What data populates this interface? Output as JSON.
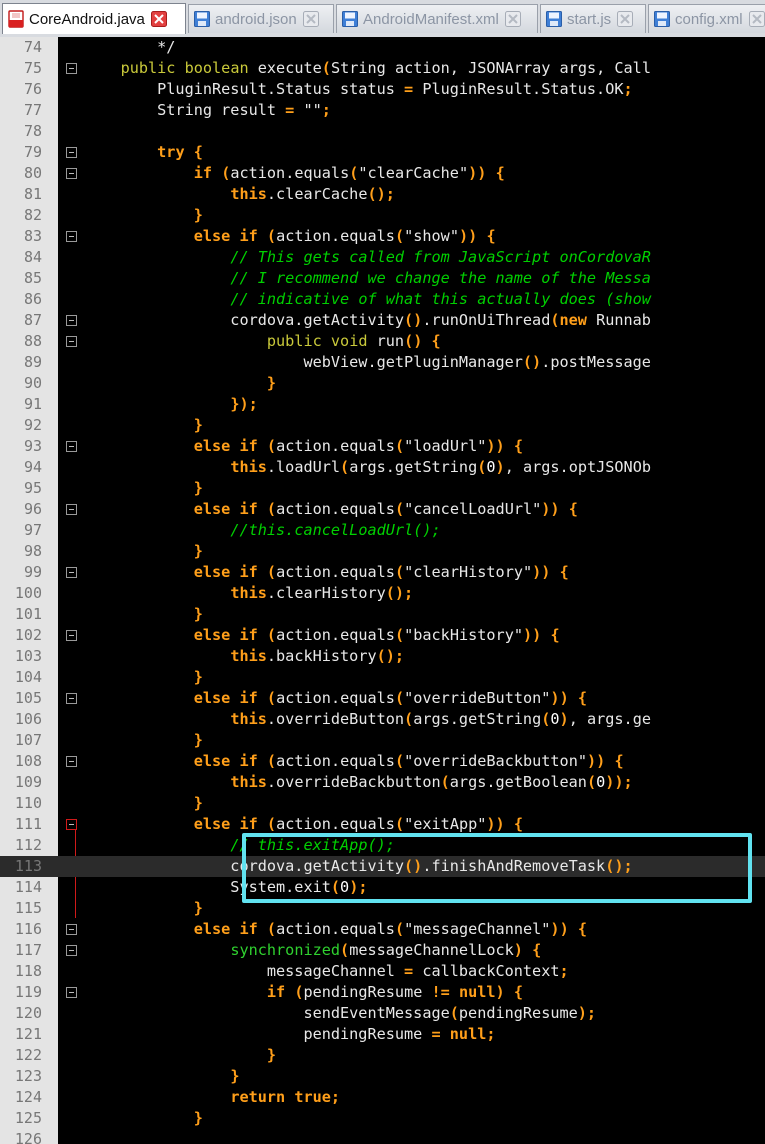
{
  "tabs": [
    {
      "label": "CoreAndroid.java",
      "active": true,
      "icon": "java-file-icon"
    },
    {
      "label": "android.json",
      "active": false,
      "icon": "json-file-icon"
    },
    {
      "label": "AndroidManifest.xml",
      "active": false,
      "icon": "xml-file-icon"
    },
    {
      "label": "start.js",
      "active": false,
      "icon": "js-file-icon"
    },
    {
      "label": "config.xml",
      "active": false,
      "icon": "xml-file-icon"
    }
  ],
  "editor": {
    "current_line": 113,
    "highlight_color": "#61e2f0",
    "lines": [
      {
        "n": "74",
        "t": "        */"
      },
      {
        "n": "75",
        "t": "    public boolean execute(String action, JSONArray args, Call"
      },
      {
        "n": "76",
        "t": "        PluginResult.Status status = PluginResult.Status.OK;"
      },
      {
        "n": "77",
        "t": "        String result = \"\";"
      },
      {
        "n": "78",
        "t": ""
      },
      {
        "n": "79",
        "t": "        try {"
      },
      {
        "n": "80",
        "t": "            if (action.equals(\"clearCache\")) {"
      },
      {
        "n": "81",
        "t": "                this.clearCache();"
      },
      {
        "n": "82",
        "t": "            }"
      },
      {
        "n": "83",
        "t": "            else if (action.equals(\"show\")) {"
      },
      {
        "n": "84",
        "t": "                // This gets called from JavaScript onCordovaR"
      },
      {
        "n": "85",
        "t": "                // I recommend we change the name of the Messa"
      },
      {
        "n": "86",
        "t": "                // indicative of what this actually does (show"
      },
      {
        "n": "87",
        "t": "                cordova.getActivity().runOnUiThread(new Runnab"
      },
      {
        "n": "88",
        "t": "                    public void run() {"
      },
      {
        "n": "89",
        "t": "                        webView.getPluginManager().postMessage"
      },
      {
        "n": "90",
        "t": "                    }"
      },
      {
        "n": "91",
        "t": "                });"
      },
      {
        "n": "92",
        "t": "            }"
      },
      {
        "n": "93",
        "t": "            else if (action.equals(\"loadUrl\")) {"
      },
      {
        "n": "94",
        "t": "                this.loadUrl(args.getString(0), args.optJSONOb"
      },
      {
        "n": "95",
        "t": "            }"
      },
      {
        "n": "96",
        "t": "            else if (action.equals(\"cancelLoadUrl\")) {"
      },
      {
        "n": "97",
        "t": "                //this.cancelLoadUrl();"
      },
      {
        "n": "98",
        "t": "            }"
      },
      {
        "n": "99",
        "t": "            else if (action.equals(\"clearHistory\")) {"
      },
      {
        "n": "100",
        "t": "                this.clearHistory();"
      },
      {
        "n": "101",
        "t": "            }"
      },
      {
        "n": "102",
        "t": "            else if (action.equals(\"backHistory\")) {"
      },
      {
        "n": "103",
        "t": "                this.backHistory();"
      },
      {
        "n": "104",
        "t": "            }"
      },
      {
        "n": "105",
        "t": "            else if (action.equals(\"overrideButton\")) {"
      },
      {
        "n": "106",
        "t": "                this.overrideButton(args.getString(0), args.ge"
      },
      {
        "n": "107",
        "t": "            }"
      },
      {
        "n": "108",
        "t": "            else if (action.equals(\"overrideBackbutton\")) {"
      },
      {
        "n": "109",
        "t": "                this.overrideBackbutton(args.getBoolean(0));"
      },
      {
        "n": "110",
        "t": "            }"
      },
      {
        "n": "111",
        "t": "            else if (action.equals(\"exitApp\")) {"
      },
      {
        "n": "112",
        "t": "                // this.exitApp();"
      },
      {
        "n": "113",
        "t": "                cordova.getActivity().finishAndRemoveTask();"
      },
      {
        "n": "114",
        "t": "                System.exit(0);"
      },
      {
        "n": "115",
        "t": "            }"
      },
      {
        "n": "116",
        "t": "            else if (action.equals(\"messageChannel\")) {"
      },
      {
        "n": "117",
        "t": "                synchronized(messageChannelLock) {"
      },
      {
        "n": "118",
        "t": "                    messageChannel = callbackContext;"
      },
      {
        "n": "119",
        "t": "                    if (pendingResume != null) {"
      },
      {
        "n": "120",
        "t": "                        sendEventMessage(pendingResume);"
      },
      {
        "n": "121",
        "t": "                        pendingResume = null;"
      },
      {
        "n": "122",
        "t": "                    }"
      },
      {
        "n": "123",
        "t": "                }"
      },
      {
        "n": "124",
        "t": "                return true;"
      },
      {
        "n": "125",
        "t": "            }"
      },
      {
        "n": "126",
        "t": ""
      }
    ]
  }
}
